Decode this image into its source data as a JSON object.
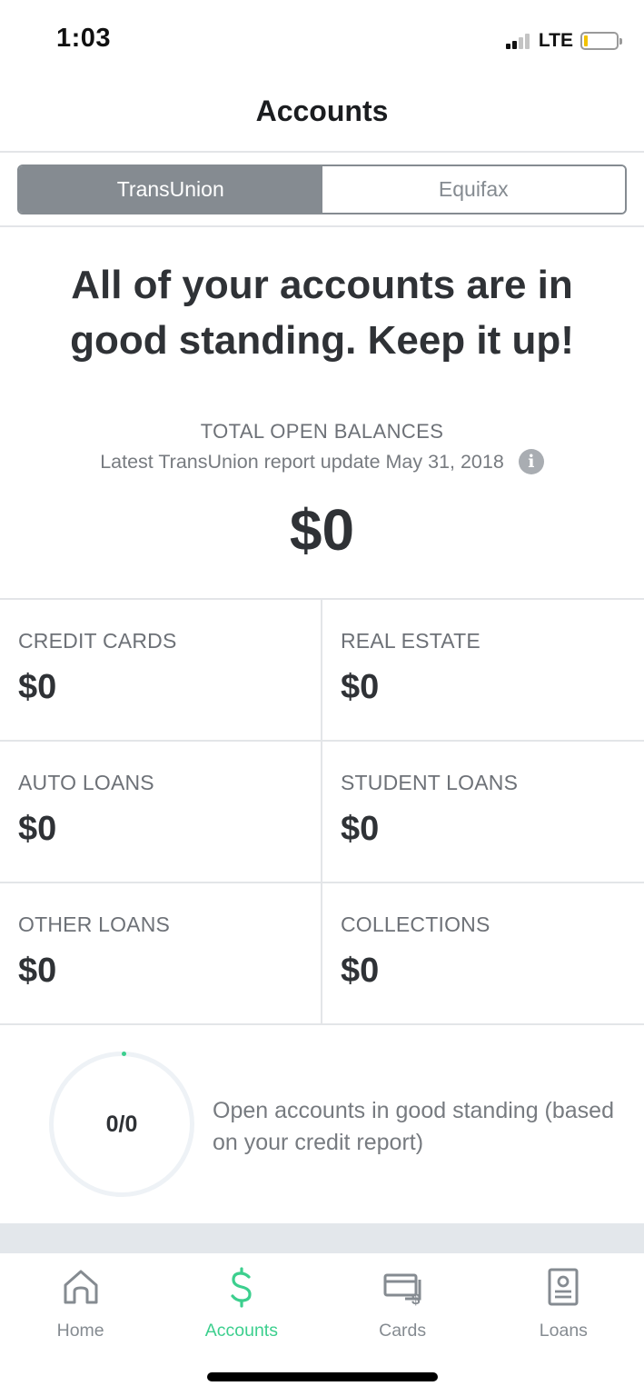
{
  "status_bar": {
    "time": "1:03",
    "network": "LTE"
  },
  "nav": {
    "title": "Accounts"
  },
  "bureau_tabs": [
    {
      "label": "TransUnion",
      "selected": true
    },
    {
      "label": "Equifax",
      "selected": false
    }
  ],
  "headline": "All of your accounts are in good standing. Keep it up!",
  "totals": {
    "label": "TOTAL OPEN BALANCES",
    "report_update": "Latest TransUnion report update May 31, 2018",
    "amount": "$0"
  },
  "categories": [
    {
      "label": "CREDIT CARDS",
      "value": "$0"
    },
    {
      "label": "REAL ESTATE",
      "value": "$0"
    },
    {
      "label": "AUTO LOANS",
      "value": "$0"
    },
    {
      "label": "STUDENT LOANS",
      "value": "$0"
    },
    {
      "label": "OTHER LOANS",
      "value": "$0"
    },
    {
      "label": "COLLECTIONS",
      "value": "$0"
    }
  ],
  "standing": {
    "ratio": "0/0",
    "description": "Open accounts in good standing (based on your credit report)"
  },
  "tabbar": [
    {
      "label": "Home",
      "icon": "home-icon",
      "active": false
    },
    {
      "label": "Accounts",
      "icon": "dollar-icon",
      "active": true
    },
    {
      "label": "Cards",
      "icon": "cards-icon",
      "active": false
    },
    {
      "label": "Loans",
      "icon": "loans-icon",
      "active": false
    }
  ],
  "colors": {
    "accent": "#3ccf8e",
    "segment_active": "#858b91",
    "text_dark": "#2f3236"
  }
}
